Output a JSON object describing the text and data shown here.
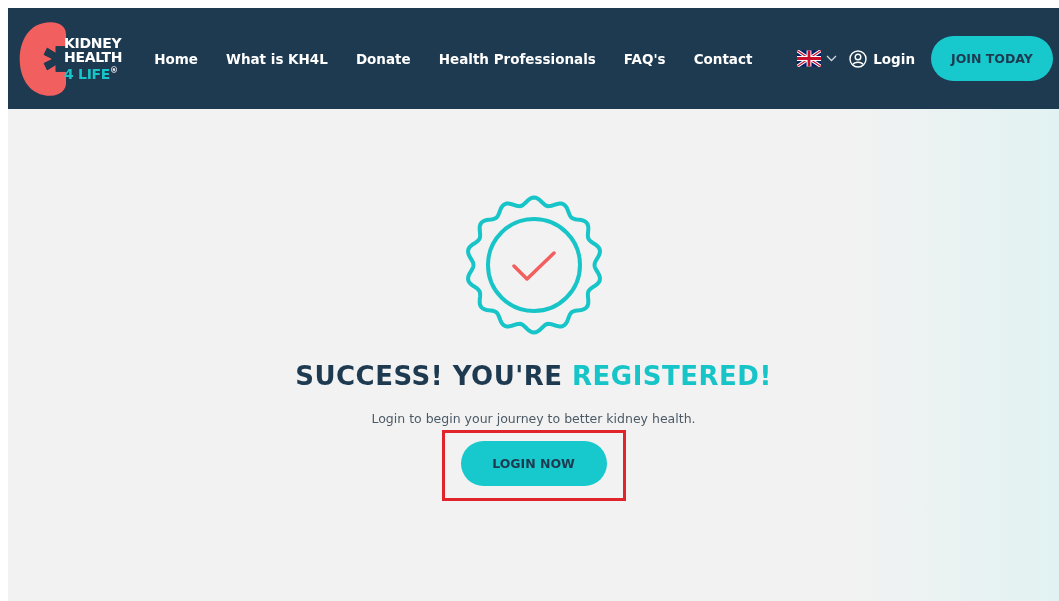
{
  "logo": {
    "lines": [
      "KIDNEY",
      "HEALTH",
      "4 LIFE"
    ],
    "mark": "®"
  },
  "nav": [
    {
      "label": "Home"
    },
    {
      "label": "What is KH4L"
    },
    {
      "label": "Donate"
    },
    {
      "label": "Health Professionals"
    },
    {
      "label": "FAQ's"
    },
    {
      "label": "Contact"
    }
  ],
  "login_link": "Login",
  "join_button": "JOIN TODAY",
  "headline": {
    "text": "SUCCESS! YOU'RE",
    "highlight": "REGISTERED!"
  },
  "subtitle": "Login to begin your journey to better kidney health.",
  "cta_button": {
    "label": "LOGIN NOW",
    "highlighted": true
  }
}
